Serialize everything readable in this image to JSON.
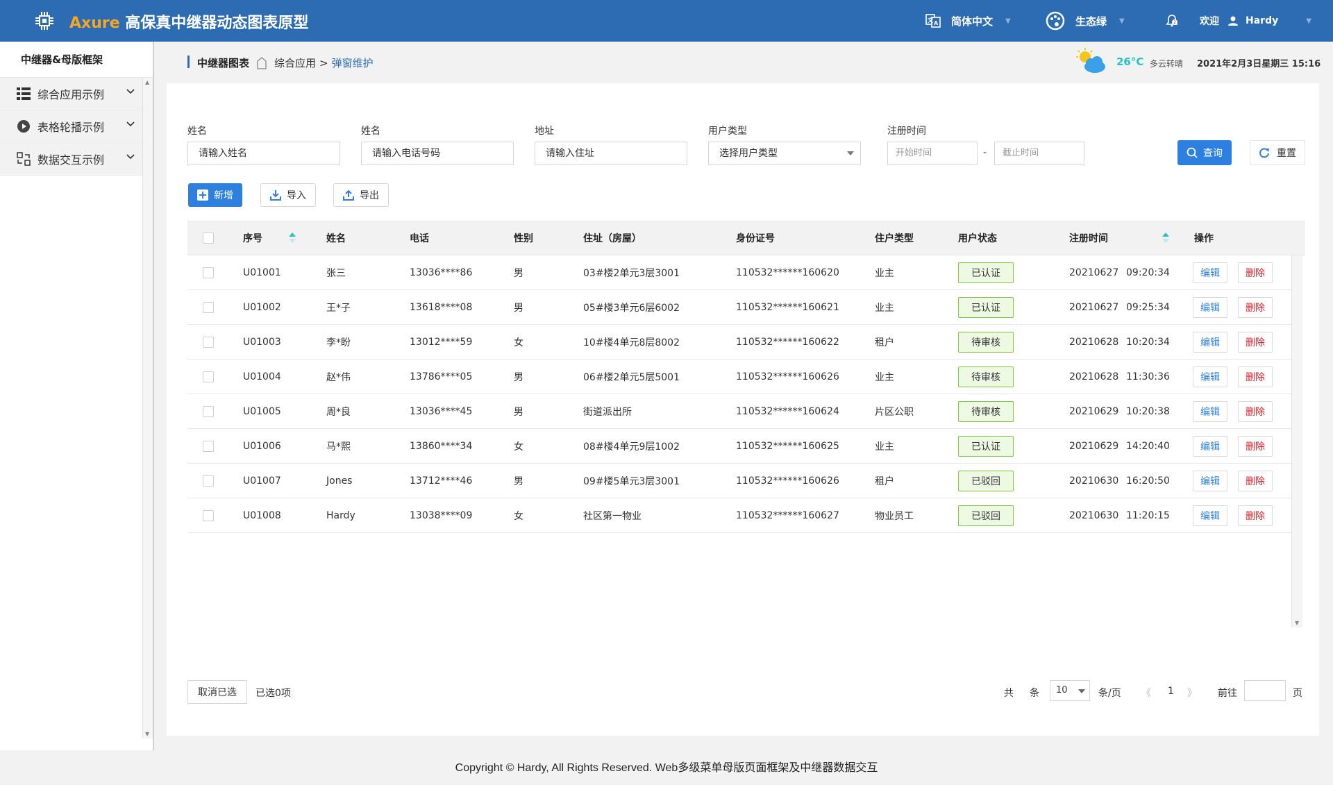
{
  "header": {
    "brand": "Axure",
    "title": "高保真中继器动态图表原型",
    "language": "简体中文",
    "theme": "生态绿",
    "welcome": "欢迎",
    "user": "Hardy"
  },
  "sidebar": {
    "title": "中继器&母版框架",
    "items": [
      {
        "label": "综合应用示例",
        "icon": "list-icon"
      },
      {
        "label": "表格轮播示例",
        "icon": "play-icon"
      },
      {
        "label": "数据交互示例",
        "icon": "exchange-icon"
      }
    ]
  },
  "breadcrumb": {
    "root": "中继器图表",
    "parent": "综合应用",
    "separator": ">",
    "current": "弹窗维护"
  },
  "weather": {
    "temp": "26°C",
    "desc": "多云转晴",
    "datetime": "2021年2月3日星期三 15:16"
  },
  "filters": {
    "name_label": "姓名",
    "name_placeholder": "请输入姓名",
    "phone_label": "姓名",
    "phone_placeholder": "请输入电话号码",
    "address_label": "地址",
    "address_placeholder": "请输入住址",
    "type_label": "用户类型",
    "type_placeholder": "选择用户类型",
    "date_label": "注册时间",
    "start_placeholder": "开始时间",
    "date_sep": "-",
    "end_placeholder": "截止时间",
    "query": "查询",
    "reset": "重置"
  },
  "toolbar": {
    "add": "新增",
    "import": "导入",
    "export": "导出"
  },
  "table": {
    "columns": [
      "序号",
      "姓名",
      "电话",
      "性别",
      "住址（房屋）",
      "身份证号",
      "住户类型",
      "用户状态",
      "注册时间",
      "操作"
    ],
    "edit": "编辑",
    "delete": "删除",
    "rows": [
      {
        "id": "U01001",
        "name": "张三",
        "phone": "13036****86",
        "gender": "男",
        "address": "03#楼2单元3层3001",
        "idcard": "110532******160620",
        "type": "业主",
        "status": "已认证",
        "date": "20210627",
        "time": "09:20:34"
      },
      {
        "id": "U01002",
        "name": "王*子",
        "phone": "13618****08",
        "gender": "男",
        "address": "05#楼3单元6层6002",
        "idcard": "110532******160621",
        "type": "业主",
        "status": "已认证",
        "date": "20210627",
        "time": "09:25:34"
      },
      {
        "id": "U01003",
        "name": "李*盼",
        "phone": "13012****59",
        "gender": "女",
        "address": "10#楼4单元8层8002",
        "idcard": "110532******160622",
        "type": "租户",
        "status": "待审核",
        "date": "20210628",
        "time": "10:20:34"
      },
      {
        "id": "U01004",
        "name": "赵*伟",
        "phone": "13786****05",
        "gender": "男",
        "address": "06#楼2单元5层5001",
        "idcard": "110532******160626",
        "type": "业主",
        "status": "待审核",
        "date": "20210628",
        "time": "11:30:36"
      },
      {
        "id": "U01005",
        "name": "周*良",
        "phone": "13036****45",
        "gender": "男",
        "address": "街道派出所",
        "idcard": "110532******160624",
        "type": "片区公职",
        "status": "待审核",
        "date": "20210629",
        "time": "10:20:38"
      },
      {
        "id": "U01006",
        "name": "马*熙",
        "phone": "13860****34",
        "gender": "女",
        "address": "08#楼4单元9层1002",
        "idcard": "110532******160625",
        "type": "业主",
        "status": "已认证",
        "date": "20210629",
        "time": "14:20:40"
      },
      {
        "id": "U01007",
        "name": "Jones",
        "phone": "13712****46",
        "gender": "男",
        "address": "09#楼5单元3层3001",
        "idcard": "110532******160626",
        "type": "租户",
        "status": "已驳回",
        "date": "20210630",
        "time": "16:20:50"
      },
      {
        "id": "U01008",
        "name": "Hardy",
        "phone": "13038****09",
        "gender": "女",
        "address": "社区第一物业",
        "idcard": "110532******160627",
        "type": "物业员工",
        "status": "已驳回",
        "date": "20210630",
        "time": "11:20:15"
      }
    ]
  },
  "footer_bar": {
    "cancel": "取消已选",
    "selected": "已选0项",
    "total_prefix": "共",
    "total_suffix": "条",
    "page_size": "10",
    "per_page": "条/页",
    "prev": "《",
    "page": "1",
    "next": "》",
    "goto": "前往",
    "page_unit": "页"
  },
  "copyright": "Copyright © Hardy, All Rights Reserved.  Web多级菜单母版页面框架及中继器数据交互",
  "colors": {
    "header_bg": "#2d6cb3",
    "brand": "#f5a623",
    "primary_button": "#2d7fe0",
    "status_border": "#7ac943",
    "delete": "#e0202a",
    "temp": "#21c3c9"
  }
}
